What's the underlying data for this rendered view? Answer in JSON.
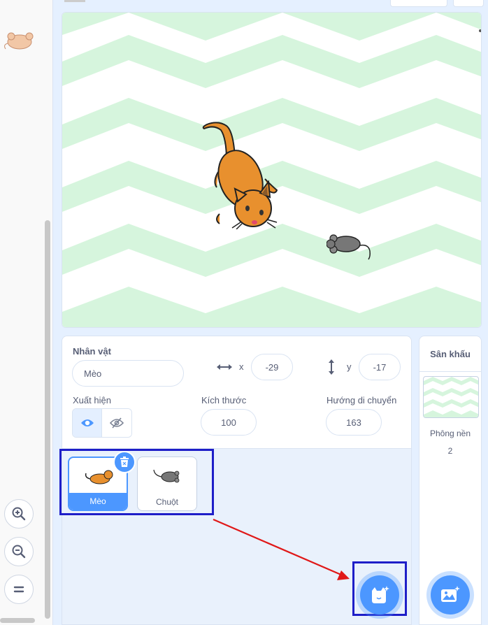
{
  "sprite_info": {
    "sprite_label": "Nhân vật",
    "sprite_name": "Mèo",
    "x_label": "x",
    "x_value": "-29",
    "y_label": "y",
    "y_value": "-17",
    "show_label": "Xuất hiện",
    "size_label": "Kích thước",
    "size_value": "100",
    "direction_label": "Hướng di chuyển",
    "direction_value": "163"
  },
  "sprites": [
    {
      "name": "Mèo",
      "selected": true
    },
    {
      "name": "Chuột",
      "selected": false
    }
  ],
  "stage_pane": {
    "title": "Sân khấu",
    "backdrops_label": "Phông nền",
    "backdrops_count": "2"
  },
  "colors": {
    "accent": "#4c97ff",
    "highlight_box": "#1e1ec8",
    "arrow": "#e01818",
    "backdrop_zigzag": "#d6f5dd"
  },
  "icons": [
    "zoom-in-icon",
    "zoom-out-icon",
    "zoom-reset-icon",
    "eye-icon",
    "eye-slash-icon",
    "trash-icon",
    "horizontal-arrows-icon",
    "vertical-arrows-icon",
    "choose-sprite-icon",
    "choose-backdrop-icon"
  ]
}
